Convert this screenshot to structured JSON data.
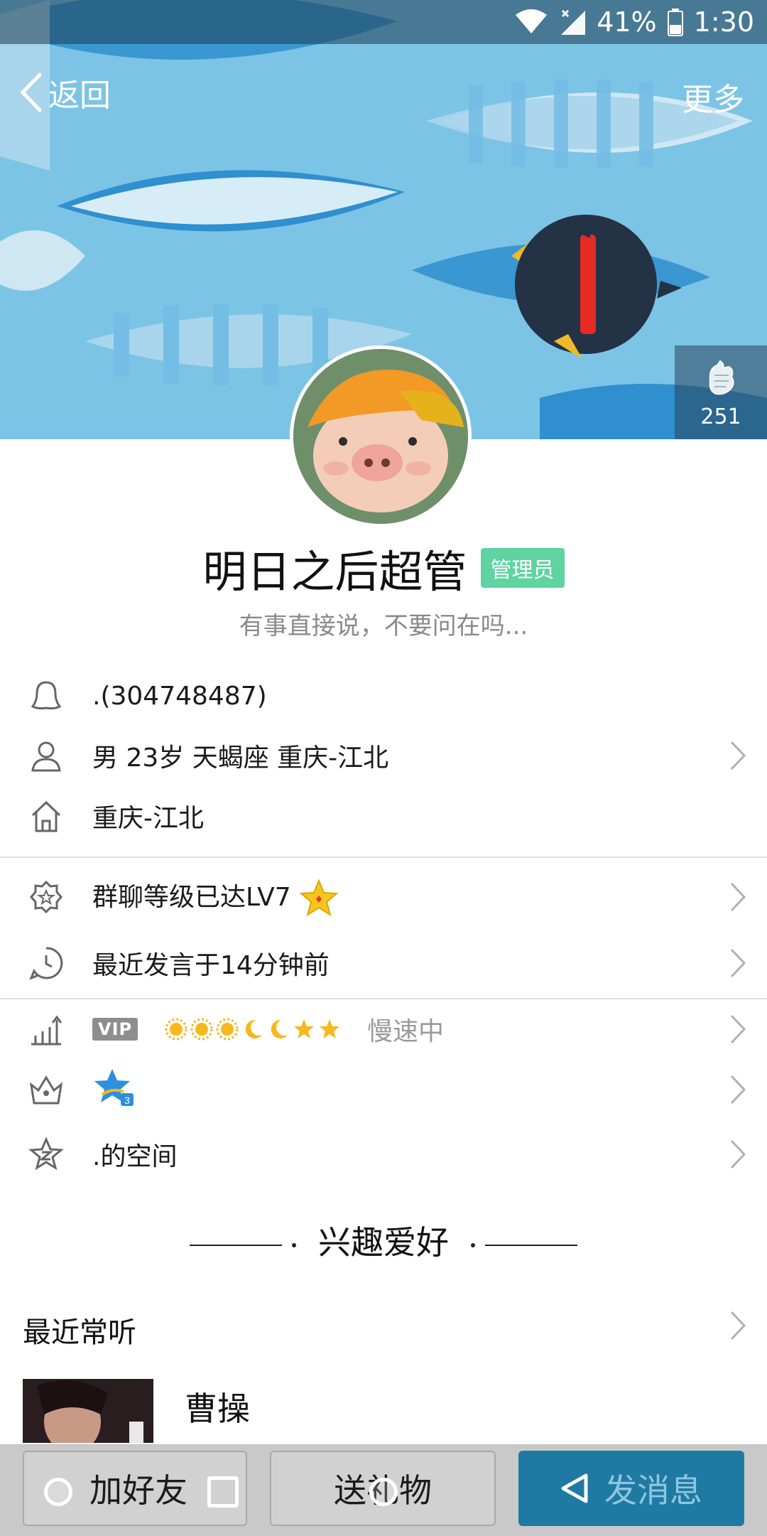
{
  "status_bar": {
    "battery": "41%",
    "time": "1:30"
  },
  "nav": {
    "back_label": "返回",
    "more_label": "更多"
  },
  "cover": {
    "likes_count": "251"
  },
  "profile": {
    "name": "明日之后超管",
    "role_badge": "管理员",
    "signature": "有事直接说，不要问在吗..."
  },
  "info": {
    "qq": ".(304748487)",
    "basic": "男  23岁  天蝎座  重庆-江北",
    "hometown": "重庆-江北",
    "group_level": "群聊等级已达LV7",
    "last_speak": "最近发言于14分钟前",
    "vip_label": "VIP",
    "vip_status": "慢速中",
    "space": ".的空间"
  },
  "interests": {
    "section_title": "兴趣爱好",
    "recent_listen": "最近常听",
    "song": "曹操"
  },
  "bottom_bar": {
    "add_friend": "加好友",
    "send_gift": "送礼物",
    "send_message": "发消息"
  },
  "colors": {
    "cover_bg": "#7cc4e6",
    "badge": "#5fd3a1",
    "primary_button": "#1f7aa3"
  },
  "icons": {
    "qq": "penguin-icon",
    "gender": "person-icon",
    "home": "house-icon",
    "level": "star-gear-icon",
    "clock": "clock-icon",
    "vip": "growth-chart-icon",
    "crown": "crown-icon",
    "space": "star-icon",
    "like": "hand-like-icon"
  }
}
